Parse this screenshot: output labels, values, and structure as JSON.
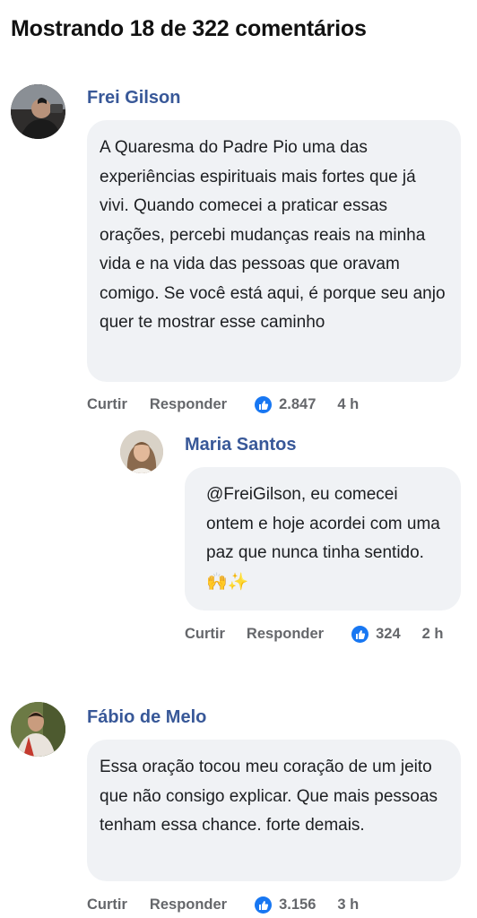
{
  "header": {
    "title": "Mostrando 18 de 322 comentários"
  },
  "comments": [
    {
      "author": "Frei Gilson",
      "text": "A Quaresma do Padre Pio uma das experiências espirituais mais fortes que já vivi. Quando comecei a praticar essas orações, percebi mudanças reais na minha vida e na vida das pessoas que oravam comigo. Se você está aqui, é porque seu anjo quer te mostrar esse caminho",
      "like_label": "Curtir",
      "reply_label": "Responder",
      "reactions": "2.847",
      "time": "4 h"
    },
    {
      "author": "Maria Santos",
      "text": "@FreiGilson, eu comecei ontem e hoje acordei com uma paz que nunca tinha sentido. 🙌✨",
      "like_label": "Curtir",
      "reply_label": "Responder",
      "reactions": "324",
      "time": "2 h"
    },
    {
      "author": "Fábio de Melo",
      "text": "Essa oração tocou meu coração de um jeito que não consigo explicar. Que mais pessoas tenham essa chance. forte demais.",
      "like_label": "Curtir",
      "reply_label": "Responder",
      "reactions": "3.156",
      "time": "3 h"
    }
  ],
  "colors": {
    "name": "#385898",
    "bubble": "#f0f2f5",
    "meta": "#65676b",
    "like": "#1877f2"
  }
}
